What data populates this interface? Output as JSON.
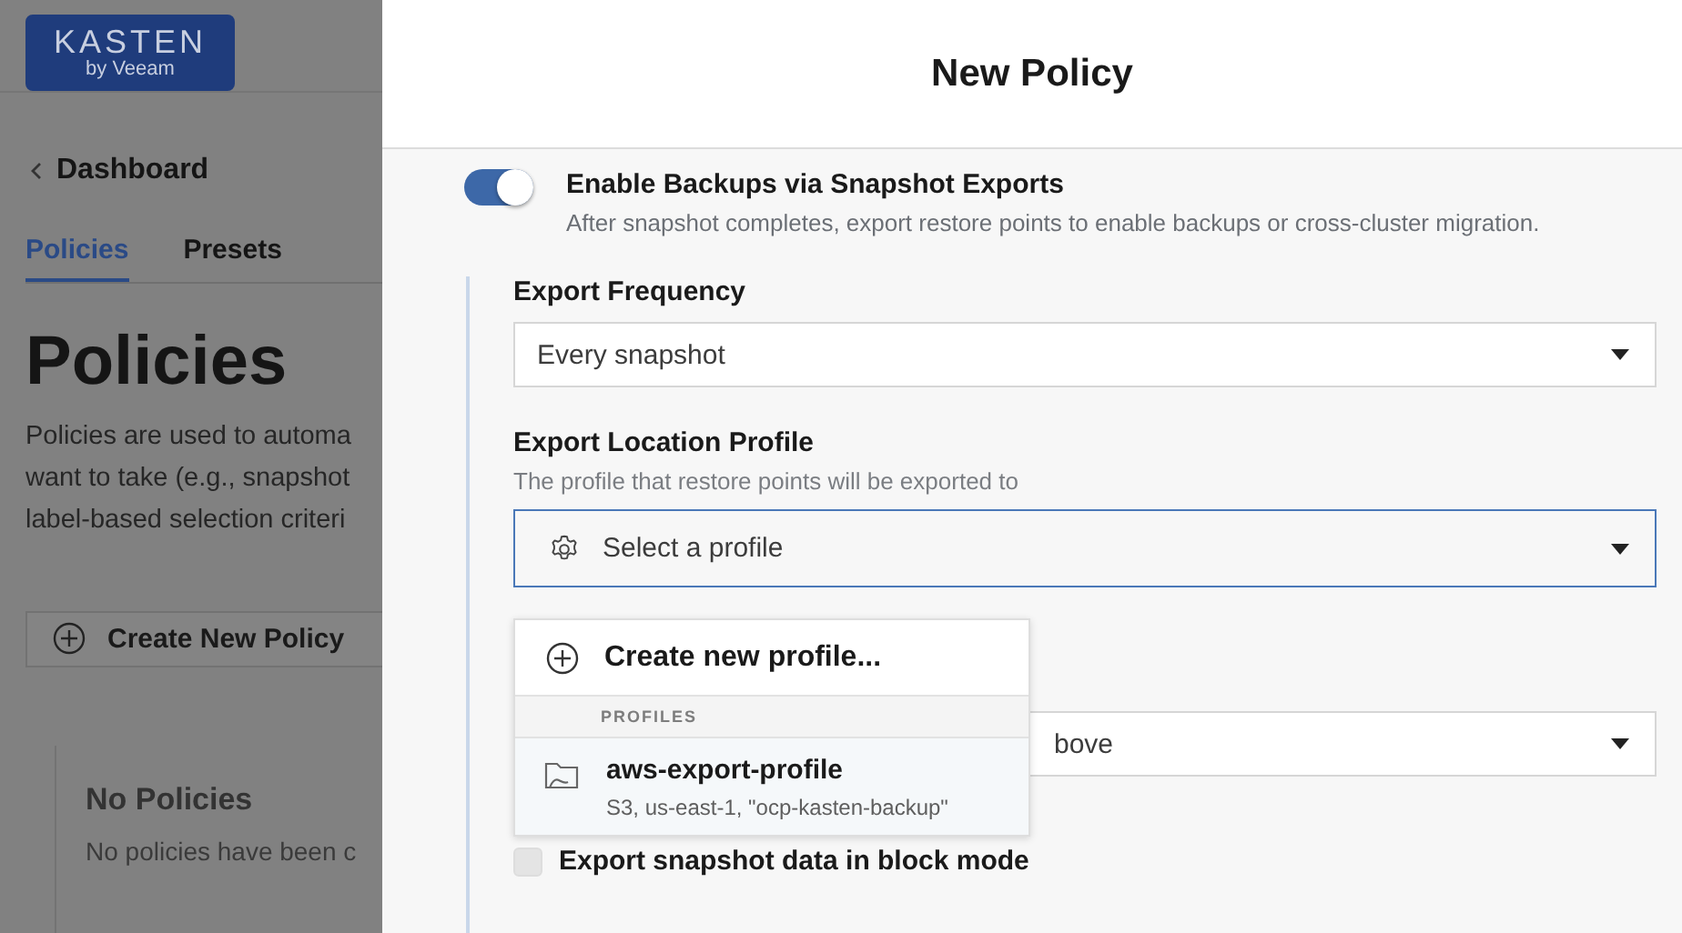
{
  "sidebar": {
    "logo": {
      "line_1": "KASTEN",
      "line_2": "by Veeam"
    },
    "back_link": "Dashboard",
    "tabs": [
      {
        "label": "Policies",
        "selected": true
      },
      {
        "label": "Presets",
        "selected": false
      }
    ],
    "heading": "Policies",
    "description_lines": [
      "Policies are used to automa",
      "want to take (e.g., snapshot",
      "label-based selection criteri"
    ],
    "create_button": "Create New Policy",
    "empty_state": {
      "title": "No Policies",
      "text": "No policies have been c"
    }
  },
  "drawer": {
    "title": "New Policy",
    "toggle": {
      "label": "Enable Backups via Snapshot Exports",
      "description": "After snapshot completes, export restore points to enable backups or cross-cluster migration.",
      "on": true
    },
    "fields": [
      {
        "label": "Export Frequency",
        "value": "Every snapshot"
      },
      {
        "label": "Export Location Profile",
        "help": "The profile that restore points will be exported to",
        "placeholder": "Select a profile",
        "focused": true
      },
      {
        "value": "bove"
      }
    ],
    "checkbox": {
      "label": "Export snapshot data in block mode",
      "checked": false
    },
    "menu": {
      "action": "Create new profile...",
      "section": "PROFILES",
      "items": [
        {
          "name": "aws-export-profile",
          "detail": "S3, us-east-1, \"ocp-kasten-backup\""
        }
      ]
    }
  }
}
